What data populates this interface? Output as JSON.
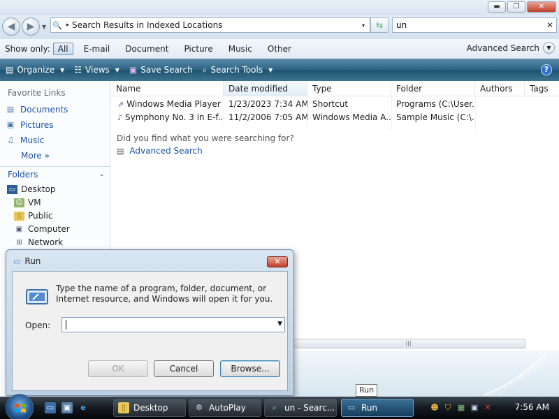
{
  "window": {
    "minimize": "▬",
    "maximize": "❐",
    "close": "✕"
  },
  "address": {
    "path_sep": "▸",
    "path": "Search Results in Indexed Locations",
    "dropdown": "▾"
  },
  "search": {
    "value": "un",
    "clear": "✕"
  },
  "show_only": {
    "label": "Show only:",
    "filters": [
      "All",
      "E-mail",
      "Document",
      "Picture",
      "Music",
      "Other"
    ],
    "active": "All",
    "advanced": "Advanced Search"
  },
  "toolbar": {
    "organize": "Organize",
    "views": "Views",
    "save_search": "Save Search",
    "search_tools": "Search Tools",
    "help": "?"
  },
  "nav": {
    "favorites_header": "Favorite Links",
    "favorites": [
      "Documents",
      "Pictures",
      "Music"
    ],
    "more": "More  »",
    "folders_header": "Folders",
    "tree": [
      "Desktop",
      "VM",
      "Public",
      "Computer",
      "Network"
    ]
  },
  "columns": [
    "Name",
    "Date modified",
    "Type",
    "Folder",
    "Authors",
    "Tags"
  ],
  "sorted_column": "Date modified",
  "rows": [
    [
      "Windows Media Player",
      "1/23/2023 7:34 AM",
      "Shortcut",
      "Programs (C:\\User..."
    ],
    [
      "Symphony No. 3 in E-f...",
      "11/2/2006 7:05 AM",
      "Windows Media A...",
      "Sample Music (C:\\..."
    ]
  ],
  "did_you_find": "Did you find what you were searching for?",
  "advanced_search_link": "Advanced Search",
  "run_dialog": {
    "title": "Run",
    "close": "✕",
    "description": "Type the name of a program, folder, document, or Internet resource, and Windows will open it for you.",
    "open_label": "Open:",
    "open_value": "",
    "ok": "OK",
    "cancel": "Cancel",
    "browse": "Browse..."
  },
  "tooltip": "Run",
  "taskbar": {
    "tasks": [
      "Desktop",
      "AutoPlay",
      "un - Searc...",
      "Run"
    ],
    "active_task": "Run",
    "clock": "7:56 AM"
  },
  "colors": {
    "accent_link": "#1a53a8",
    "toolbar": "#1f5370",
    "taskbar": "#14191f"
  }
}
